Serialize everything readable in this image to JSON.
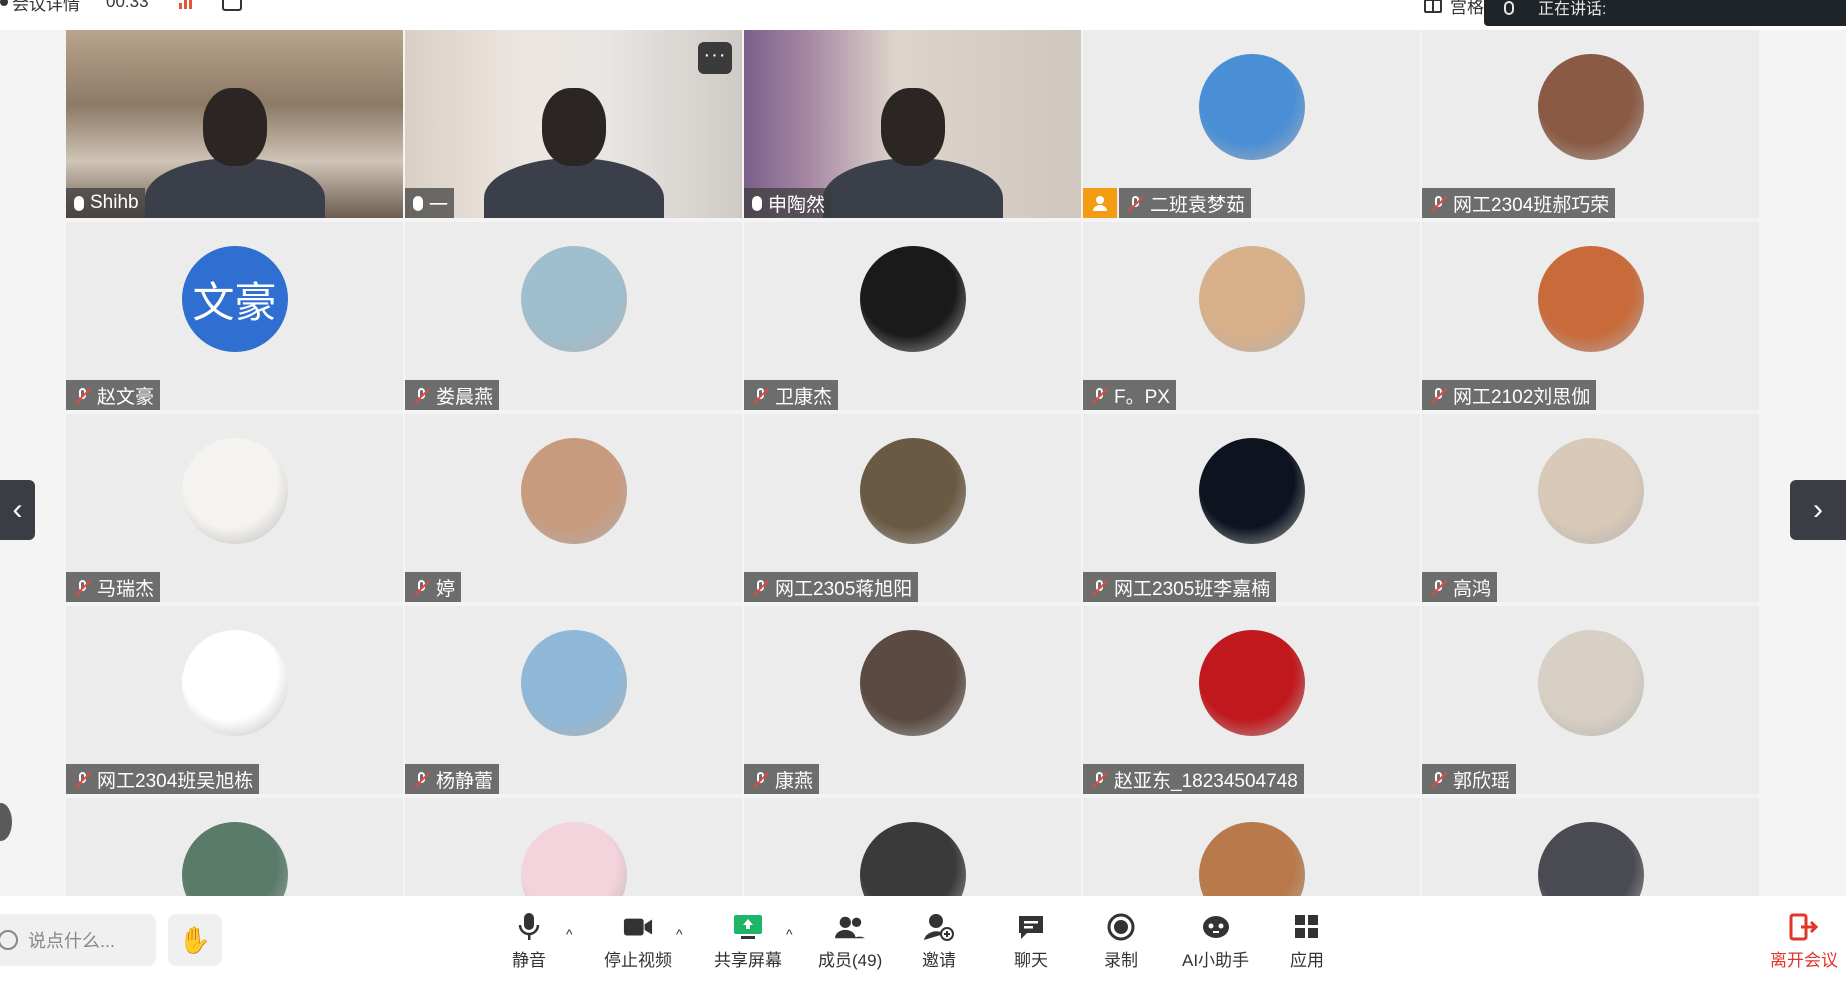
{
  "topbar": {
    "meeting_info": "会议详情",
    "timer": "00:33",
    "grid_label": "宫格",
    "speaking_label": "正在讲话:"
  },
  "tiles": [
    {
      "name": "Shihb",
      "mic": "on",
      "type": "video",
      "scene": "bookshelf"
    },
    {
      "name": "一",
      "mic": "on",
      "type": "video",
      "scene": "curtain",
      "more": "···"
    },
    {
      "name": "申陶然",
      "mic": "on",
      "type": "video",
      "scene": "room"
    },
    {
      "name": "二班袁梦茹",
      "mic": "off",
      "type": "avatar",
      "host": true,
      "color": "#4a8fd6"
    },
    {
      "name": "网工2304班郝巧荣",
      "mic": "off",
      "type": "avatar",
      "color": "#8a5a44"
    },
    {
      "name": "赵文豪",
      "mic": "off",
      "type": "avatar-text",
      "avatar_text": "文豪"
    },
    {
      "name": "娄晨燕",
      "mic": "off",
      "type": "avatar",
      "color": "#9fbfcf"
    },
    {
      "name": "卫康杰",
      "mic": "off",
      "type": "avatar",
      "color": "#1a1a1a"
    },
    {
      "name": "F。PX",
      "mic": "off",
      "type": "avatar",
      "color": "#d8b08a"
    },
    {
      "name": "网工2102刘思伽",
      "mic": "off",
      "type": "avatar",
      "color": "#c86a3a"
    },
    {
      "name": "马瑞杰",
      "mic": "off",
      "type": "avatar",
      "color": "#f5f3ef"
    },
    {
      "name": "婷",
      "mic": "off",
      "type": "avatar",
      "color": "#c89a7e"
    },
    {
      "name": "网工2305蒋旭阳",
      "mic": "off",
      "type": "avatar",
      "color": "#6a5a44"
    },
    {
      "name": "网工2305班李嘉楠",
      "mic": "off",
      "type": "avatar",
      "color": "#0d1420"
    },
    {
      "name": "高鸿",
      "mic": "off",
      "type": "avatar",
      "color": "#d9c9b8"
    },
    {
      "name": "网工2304班吴旭栋",
      "mic": "off",
      "type": "avatar",
      "color": "#ffffff"
    },
    {
      "name": "杨静蕾",
      "mic": "off",
      "type": "avatar",
      "color": "#8fb8d8"
    },
    {
      "name": "康燕",
      "mic": "off",
      "type": "avatar",
      "color": "#5a4a42"
    },
    {
      "name": "赵亚东_18234504748",
      "mic": "off",
      "type": "avatar",
      "color": "#c0181c"
    },
    {
      "name": "郭欣瑶",
      "mic": "off",
      "type": "avatar",
      "color": "#d8d0c4"
    },
    {
      "name": "",
      "mic": "off",
      "type": "avatar",
      "color": "#5a7a6a",
      "partial": true
    },
    {
      "name": "",
      "mic": "off",
      "type": "avatar",
      "color": "#f3d3dc",
      "partial": true
    },
    {
      "name": "",
      "mic": "off",
      "type": "avatar",
      "color": "#3a3a3a",
      "partial": true
    },
    {
      "name": "",
      "mic": "off",
      "type": "avatar",
      "color": "#b87a4a",
      "partial": true
    },
    {
      "name": "",
      "mic": "off",
      "type": "avatar",
      "color": "#4a4a52",
      "partial": true
    }
  ],
  "toolbar": {
    "chat_placeholder": "说点什么...",
    "mute": "静音",
    "stop_video": "停止视频",
    "share_screen": "共享屏幕",
    "members": "成员(49)",
    "invite": "邀请",
    "chat": "聊天",
    "record": "录制",
    "ai_assistant": "AI小助手",
    "apps": "应用",
    "leave": "离开会议"
  },
  "colors": {
    "leave": "#e2352a",
    "host_badge": "#f39c12",
    "muted_slash": "#e9463b"
  }
}
